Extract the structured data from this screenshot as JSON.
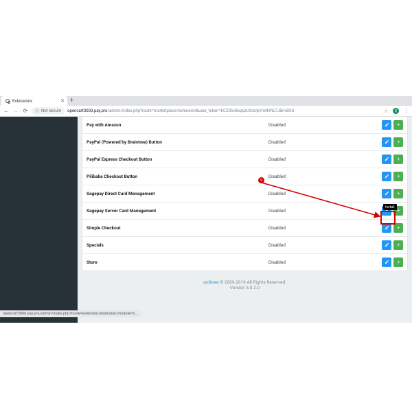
{
  "window": {
    "minimize": "—",
    "maximize": "□",
    "close": "✕"
  },
  "tab": {
    "title": "Extensions",
    "close": "✕",
    "new": "+"
  },
  "addr": {
    "back": "←",
    "forward": "→",
    "reload": "⟳",
    "insecure_icon": "ⓘ",
    "insecure_label": "Not secure",
    "host": "opencart3000.pay.pro",
    "path": "/admin/index.php?route=marketplace/extension&user_token=ECZd5vBoq6zUSnUpVmN9hE7JBnvBXG",
    "star": "☆",
    "avatar": "K",
    "menu": "⋮"
  },
  "table": {
    "rows": [
      {
        "name": "Pay with Amazon",
        "status": "Disabled"
      },
      {
        "name": "PayPal (Powered by Braintree) Button",
        "status": "Disabled"
      },
      {
        "name": "PayPal Express Checkout Button",
        "status": "Disabled"
      },
      {
        "name": "Pilibaba Checkout Button",
        "status": "Disabled"
      },
      {
        "name": "Sagepay Direct Card Management",
        "status": "Disabled"
      },
      {
        "name": "Sagepay Server Card Management",
        "status": "Disabled"
      },
      {
        "name": "Simple Checkout",
        "status": "Disabled"
      },
      {
        "name": "Specials",
        "status": "Disabled"
      },
      {
        "name": "Store",
        "status": "Disabled"
      }
    ]
  },
  "footer": {
    "brand": "ocStore",
    "rights": " © 2009-2019 All Rights Reserved.",
    "version": "Version 3.0.2.0"
  },
  "annotation": {
    "step": "9",
    "tooltip": "Install"
  },
  "statusbar": "opencart3000.pay.pro/admin/index.php?route=extension/extension/module/in..."
}
